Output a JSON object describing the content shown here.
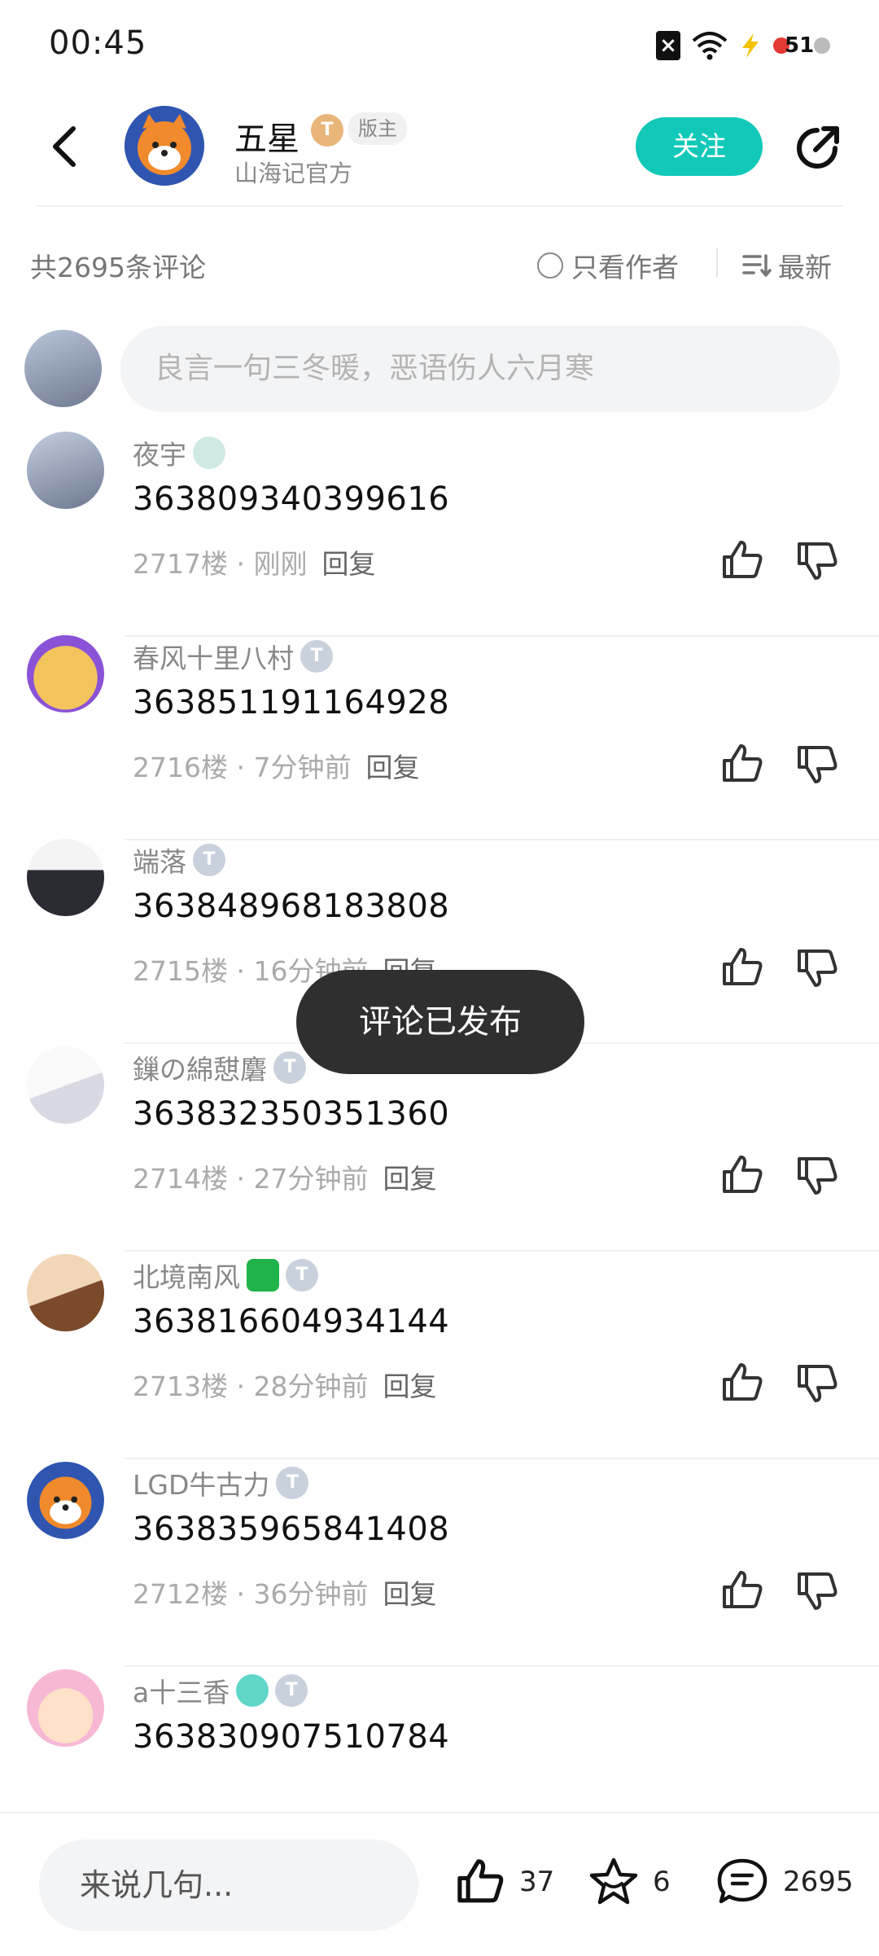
{
  "status_bar": {
    "time": "00:45",
    "battery": "51"
  },
  "header": {
    "name": "五星",
    "level_badge": "T",
    "role_tag": "版主",
    "subtitle": "山海记官方",
    "follow_label": "关注"
  },
  "filter": {
    "count_label": "共2695条评论",
    "only_author_label": "只看作者",
    "sort_label": "最新"
  },
  "compose": {
    "placeholder": "良言一句三冬暖，恶语伤人六月寒"
  },
  "comments": [
    {
      "name": "夜宇",
      "text": "363809340399616",
      "meta": "2717楼 · 刚刚",
      "reply": "回复"
    },
    {
      "name": "春风十里八村",
      "text": "363851191164928",
      "meta": "2716楼 · 7分钟前",
      "reply": "回复"
    },
    {
      "name": "端落",
      "text": "363848968183808",
      "meta": "2715楼 · 16分钟前",
      "reply": "回复"
    },
    {
      "name": "鏁の綿憇麏",
      "text": "363832350351360",
      "meta": "2714楼 · 27分钟前",
      "reply": "回复"
    },
    {
      "name": "北境南风",
      "text": "363816604934144",
      "meta": "2713楼 · 28分钟前",
      "reply": "回复"
    },
    {
      "name": "LGD牛古力",
      "text": "363835965841408",
      "meta": "2712楼 · 36分钟前",
      "reply": "回复"
    },
    {
      "name": "a十三香",
      "text": "363830907510784",
      "meta": "",
      "reply": ""
    }
  ],
  "toast": "评论已发布",
  "bottom": {
    "input_placeholder": "来说几句...",
    "like_count": "37",
    "fav_count": "6",
    "comment_count": "2695"
  },
  "colors": {
    "accent": "#12c9b9",
    "toast_bg": "#2f2f2f"
  }
}
